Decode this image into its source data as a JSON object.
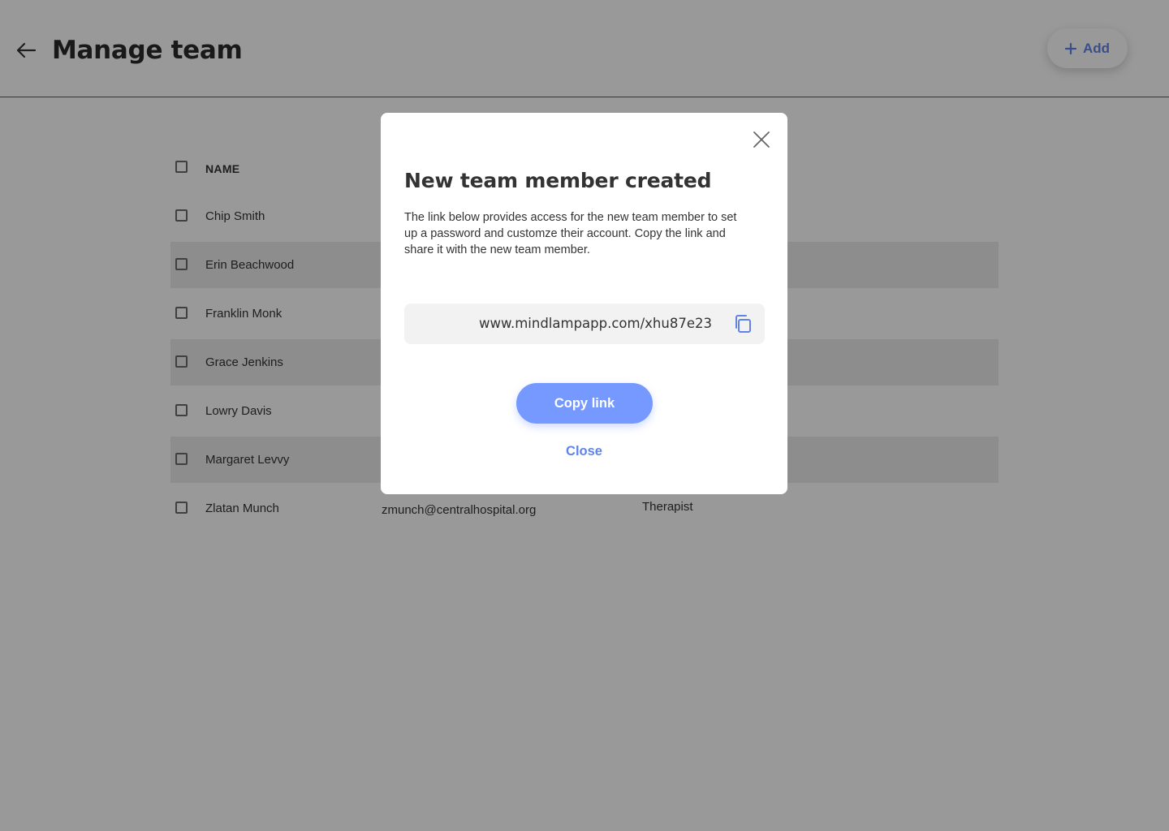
{
  "header": {
    "title": "Manage team",
    "add_label": "Add"
  },
  "table": {
    "columns": {
      "name": "NAME"
    },
    "rows": [
      {
        "name": "Chip Smith",
        "email": "",
        "role": ""
      },
      {
        "name": "Erin Beachwood",
        "email": "",
        "role": ""
      },
      {
        "name": "Franklin Monk",
        "email": "",
        "role": ""
      },
      {
        "name": "Grace Jenkins",
        "email": "",
        "role": ""
      },
      {
        "name": "Lowry Davis",
        "email": "",
        "role": ""
      },
      {
        "name": "Margaret Levvy",
        "email": "",
        "role": ""
      },
      {
        "name": "Zlatan Munch",
        "email": "zmunch@centralhospital.org",
        "role": "Therapist"
      }
    ]
  },
  "modal": {
    "title": "New team member created",
    "description": "The link below provides access for the new team member to set up a password and customze their account. Copy the link and share it with the new team member.",
    "link": "www.mindlampapp.com/xhu87e23",
    "copy_label": "Copy link",
    "close_label": "Close"
  },
  "colors": {
    "accent": "#6083e9",
    "primary_button": "#7599ff",
    "overlay": "rgba(0,0,0,0.40)"
  }
}
